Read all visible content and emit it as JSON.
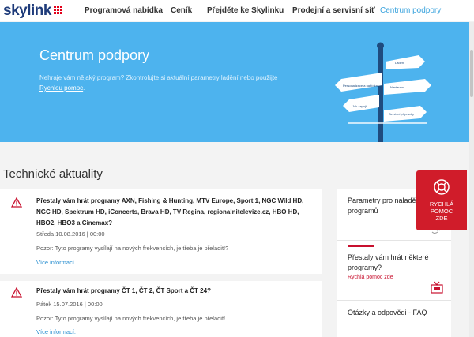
{
  "nav": {
    "logo": "skylink",
    "items": [
      {
        "label": "Programová nabídka"
      },
      {
        "label": "Ceník"
      },
      {
        "label": "Přejděte ke Skylinku"
      },
      {
        "label": "Prodejní a servisní síť"
      },
      {
        "label": "Centrum podpory"
      }
    ]
  },
  "hero": {
    "title": "Centrum podpory",
    "text": "Nehraje vám nějaký program? Zkontrolujte si aktuální parametry ladění nebo použijte",
    "link": "Rychlou pomoc",
    "link_suffix": ".",
    "sign_labels": [
      "Personalizace a nabídka",
      "Jak zapojit",
      "Nastavení",
      "Servisní přípravky",
      "Ladění"
    ]
  },
  "section": {
    "title": "Technické aktuality"
  },
  "news": [
    {
      "title": "Přestaly vám hrát programy AXN, Fishing & Hunting, MTV Europe, Sport 1, NGC Wild HD, NGC HD, Spektrum HD, iConcerts, Brava HD, TV Regina, regionalnitelevize.cz, HBO HD, HBO2, HBO3 a Cinemax?",
      "date": "Středa 10.08.2016 | 00:00",
      "body": "Pozor: Tyto programy vysílají na nových frekvencích, je třeba je přeladit!?",
      "more": "Více informací."
    },
    {
      "title": "Přestaly vám hrát programy ČT 1, ČT 2, ČT Sport a ČT 24?",
      "date": "Pátek 15.07.2016 | 00:00",
      "body": "Pozor: Tyto programy vysílají na nových frekvencích, je třeba je přeladit!",
      "more": "Více informací."
    }
  ],
  "side": [
    {
      "title": "Parametry pro naladění programů",
      "sub": ""
    },
    {
      "title": "Přestaly vám hrát některé programy?",
      "sub": "Rychlá pomoc zde"
    },
    {
      "title": "Otázky a odpovědi - FAQ",
      "sub": ""
    }
  ],
  "help": {
    "label": "RYCHLÁ POMOC ZDE",
    "line1": "RYCHLÁ",
    "line2": "POMOC",
    "line3": "ZDE"
  },
  "colors": {
    "accent": "#4db3ee",
    "brand_red": "#d01c2a",
    "link": "#2a8fd0",
    "logo": "#1e3b7a"
  }
}
